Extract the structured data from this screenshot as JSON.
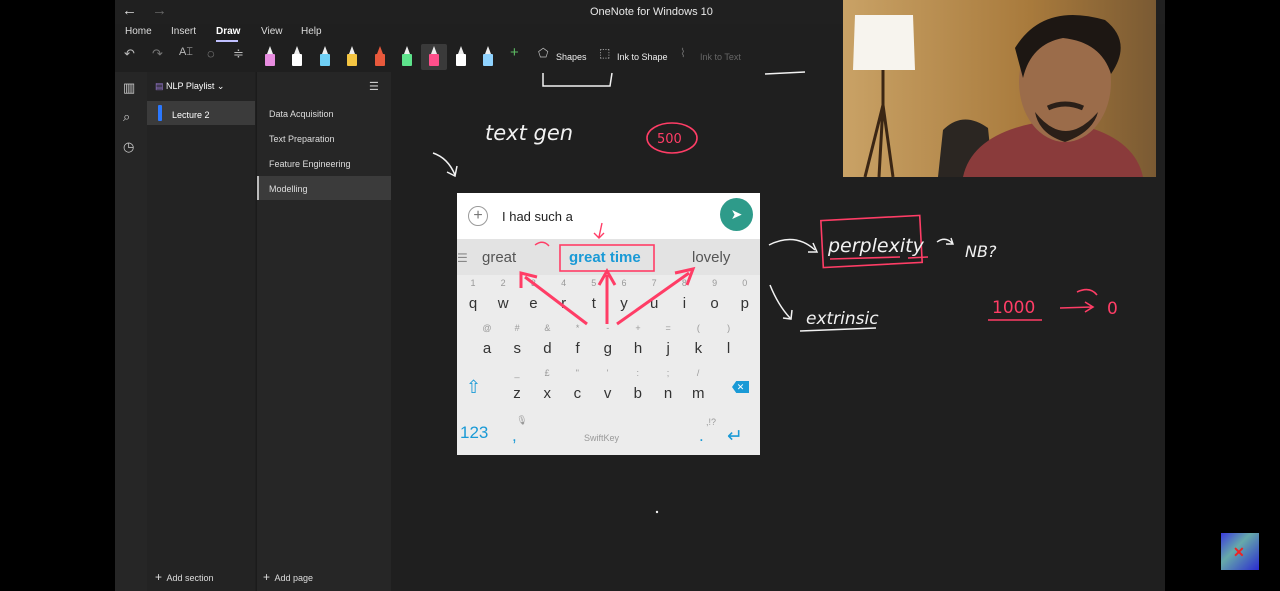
{
  "window": {
    "title": "OneNote for Windows 10",
    "back_glyph": "←",
    "forward_glyph": "→"
  },
  "menu": {
    "items": [
      "Home",
      "Insert",
      "Draw",
      "View",
      "Help"
    ],
    "active": "Draw"
  },
  "toolbar": {
    "shapes_label": "Shapes",
    "ink_to_shape_label": "Ink to Shape",
    "ink_to_text_label": "Ink to Text",
    "pen_colors": [
      "#e88de0",
      "#ffffff",
      "#6fcff5",
      "#f4c542",
      "#e8593c",
      "#5de38b",
      "#ff4f8b",
      "#ffffff",
      "#8fd3ff"
    ]
  },
  "notebook": {
    "name": "NLP Playlist",
    "sections": [
      "Lecture 2"
    ],
    "section_color": "#2b78ff",
    "pages": [
      "Data Acquisition",
      "Text Preparation",
      "Feature Engineering",
      "Modelling"
    ],
    "selected_page": "Modelling",
    "add_section_label": "Add section",
    "add_page_label": "Add page"
  },
  "canvas": {
    "handwriting": {
      "text_gen": "text gen",
      "count": "500",
      "perplexity": "perplexity",
      "nb": "NB?",
      "extrinsic": "extrinsic",
      "thousand": "1000",
      "zero": "0"
    },
    "ink_colors": {
      "white": "#f2f2f2",
      "red": "#ff3d66"
    }
  },
  "phone_keyboard": {
    "input_text": "I had such a",
    "suggestions": [
      "great",
      "great time",
      "lovely"
    ],
    "row1_keys": [
      "q",
      "w",
      "e",
      "r",
      "t",
      "y",
      "u",
      "i",
      "o",
      "p"
    ],
    "row1_hints": [
      "1",
      "2",
      "3",
      "4",
      "5",
      "6",
      "7",
      "8",
      "9",
      "0"
    ],
    "row2_keys": [
      "a",
      "s",
      "d",
      "f",
      "g",
      "h",
      "j",
      "k",
      "l"
    ],
    "row2_hints": [
      "@",
      "#",
      "&",
      "*",
      "-",
      "+",
      "=",
      "(",
      ")"
    ],
    "row3_keys": [
      "z",
      "x",
      "c",
      "v",
      "b",
      "n",
      "m"
    ],
    "row3_hints": [
      "_",
      "£",
      "\"",
      "'",
      ":",
      ";",
      "/"
    ],
    "numbers_key": "123",
    "comma_key": ",",
    "brand": "SwiftKey",
    "period_key": ".",
    "hint_punct": ",!?",
    "accent_color": "#1a9ad6"
  }
}
